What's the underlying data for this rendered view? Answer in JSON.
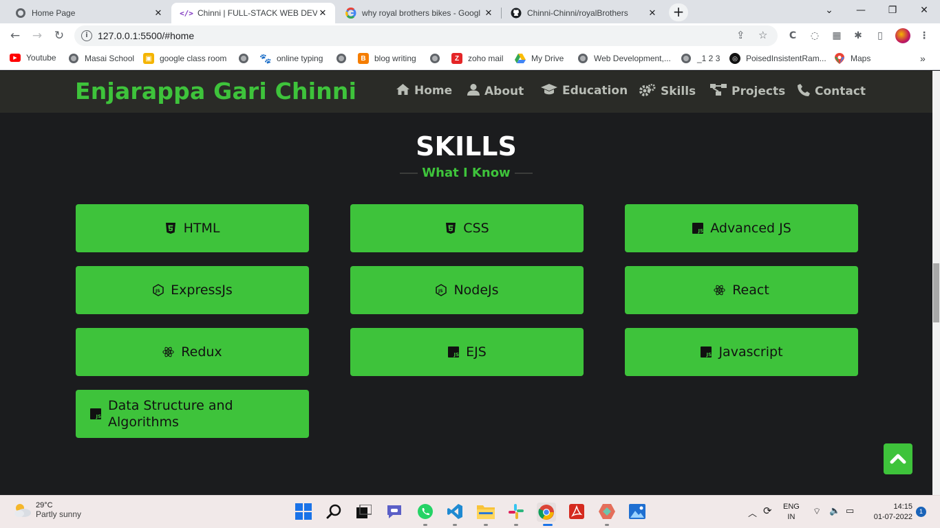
{
  "browser": {
    "tabs": [
      {
        "title": "Home Page",
        "favicon": "globe-icon",
        "active": false
      },
      {
        "title": "Chinni | FULL-STACK WEB DEVELO",
        "favicon": "code-icon",
        "active": true
      },
      {
        "title": "why royal brothers bikes - Googl",
        "favicon": "google-icon",
        "active": false
      },
      {
        "title": "Chinni-Chinni/royalBrothers",
        "favicon": "github-icon",
        "active": false
      }
    ],
    "url": "127.0.0.1:5500/#home",
    "bookmarks": [
      {
        "label": "Youtube",
        "icon": "youtube-icon"
      },
      {
        "label": "Masai School",
        "icon": "globe-icon"
      },
      {
        "label": "google class room",
        "icon": "classroom-icon"
      },
      {
        "label": "online typing",
        "icon": "paw-icon"
      },
      {
        "label": "blog writing",
        "icon": "blogger-icon"
      },
      {
        "label": "zoho mail",
        "icon": "zoho-icon"
      },
      {
        "label": "My Drive",
        "icon": "drive-icon"
      },
      {
        "label": "Web Development,...",
        "icon": "globe-icon"
      },
      {
        "label": "_1 2 3",
        "icon": "globe-icon"
      },
      {
        "label": "PoisedInsistentRam...",
        "icon": "replit-icon"
      },
      {
        "label": "Maps",
        "icon": "maps-icon"
      }
    ]
  },
  "site": {
    "brand": "Enjarappa Gari Chinni",
    "nav": [
      {
        "label": "Home",
        "icon": "home-icon"
      },
      {
        "label": "About",
        "icon": "user-icon"
      },
      {
        "label": "Education",
        "icon": "graduation-cap-icon"
      },
      {
        "label": "Skills",
        "icon": "gears-icon"
      },
      {
        "label": "Projects",
        "icon": "project-diagram-icon"
      },
      {
        "label": "Contact",
        "icon": "phone-icon"
      }
    ],
    "section_title": "SKILLS",
    "section_subtitle": "What I Know",
    "skills": [
      {
        "label": "HTML",
        "icon": "html5-icon"
      },
      {
        "label": "CSS",
        "icon": "css3-icon"
      },
      {
        "label": "Advanced JS",
        "icon": "js-square-icon"
      },
      {
        "label": "ExpressJs",
        "icon": "nodejs-icon"
      },
      {
        "label": "NodeJs",
        "icon": "nodejs-icon"
      },
      {
        "label": "React",
        "icon": "react-icon"
      },
      {
        "label": "Redux",
        "icon": "react-icon"
      },
      {
        "label": "EJS",
        "icon": "js-square-icon"
      },
      {
        "label": "Javascript",
        "icon": "js-square-icon"
      },
      {
        "label": "Data Structure and\nAlgorithms",
        "icon": "js-square-icon"
      }
    ],
    "accent_color": "#3ec33b"
  },
  "taskbar": {
    "temperature": "29°C",
    "condition": "Partly sunny",
    "language": "ENG",
    "region": "IN",
    "time": "14:15",
    "date": "01-07-2022",
    "notifications": "1"
  }
}
